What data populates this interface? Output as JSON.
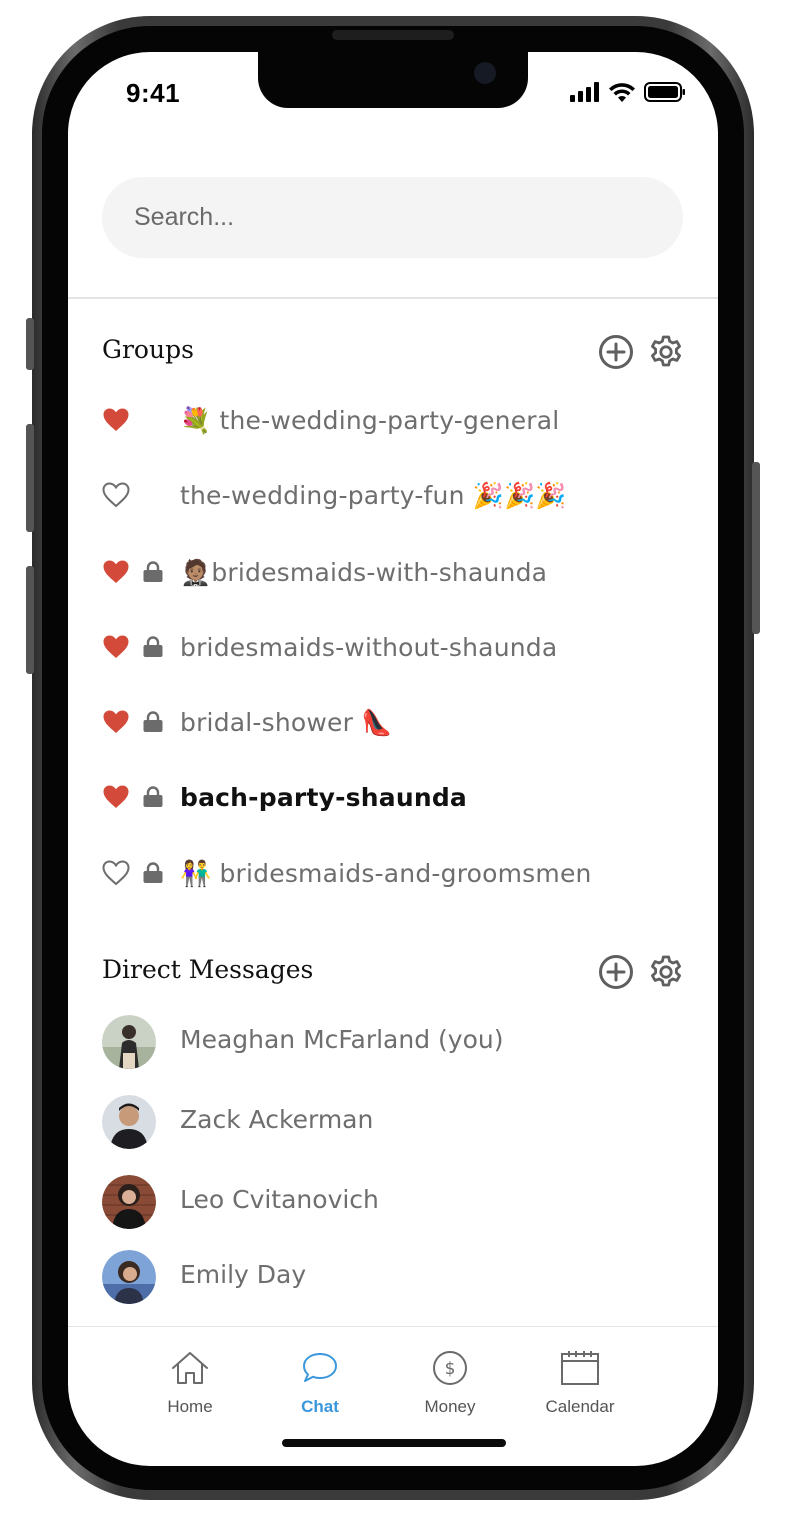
{
  "status_bar": {
    "time": "9:41"
  },
  "search": {
    "placeholder": "Search..."
  },
  "groups": {
    "title": "Groups",
    "items": [
      {
        "favorite": true,
        "locked": false,
        "label": "💐 the-wedding-party-general",
        "bold": false
      },
      {
        "favorite": false,
        "locked": false,
        "label": "the-wedding-party-fun 🎉🎉🎉",
        "bold": false
      },
      {
        "favorite": true,
        "locked": true,
        "label": "🤵🏽bridesmaids-with-shaunda",
        "bold": false
      },
      {
        "favorite": true,
        "locked": true,
        "label": "bridesmaids-without-shaunda",
        "bold": false
      },
      {
        "favorite": true,
        "locked": true,
        "label": "bridal-shower 👠",
        "bold": false
      },
      {
        "favorite": true,
        "locked": true,
        "label": "bach-party-shaunda",
        "bold": true
      },
      {
        "favorite": false,
        "locked": true,
        "label": "👫 bridesmaids-and-groomsmen",
        "bold": false
      }
    ]
  },
  "direct_messages": {
    "title": "Direct Messages",
    "items": [
      {
        "name": "Meaghan McFarland (you)"
      },
      {
        "name": "Zack Ackerman"
      },
      {
        "name": "Leo Cvitanovich"
      },
      {
        "name": "Emily Day"
      }
    ]
  },
  "tabbar": {
    "items": [
      {
        "label": "Home",
        "icon": "home-icon",
        "active": false
      },
      {
        "label": "Chat",
        "icon": "chat-bubble-icon",
        "active": true
      },
      {
        "label": "Money",
        "icon": "dollar-circle-icon",
        "active": false
      },
      {
        "label": "Calendar",
        "icon": "calendar-icon",
        "active": false
      }
    ]
  },
  "colors": {
    "heart": "#d44a3a",
    "accent": "#3a97dc",
    "text_muted": "#6e6e6e",
    "search_bg": "#f4f4f4"
  }
}
